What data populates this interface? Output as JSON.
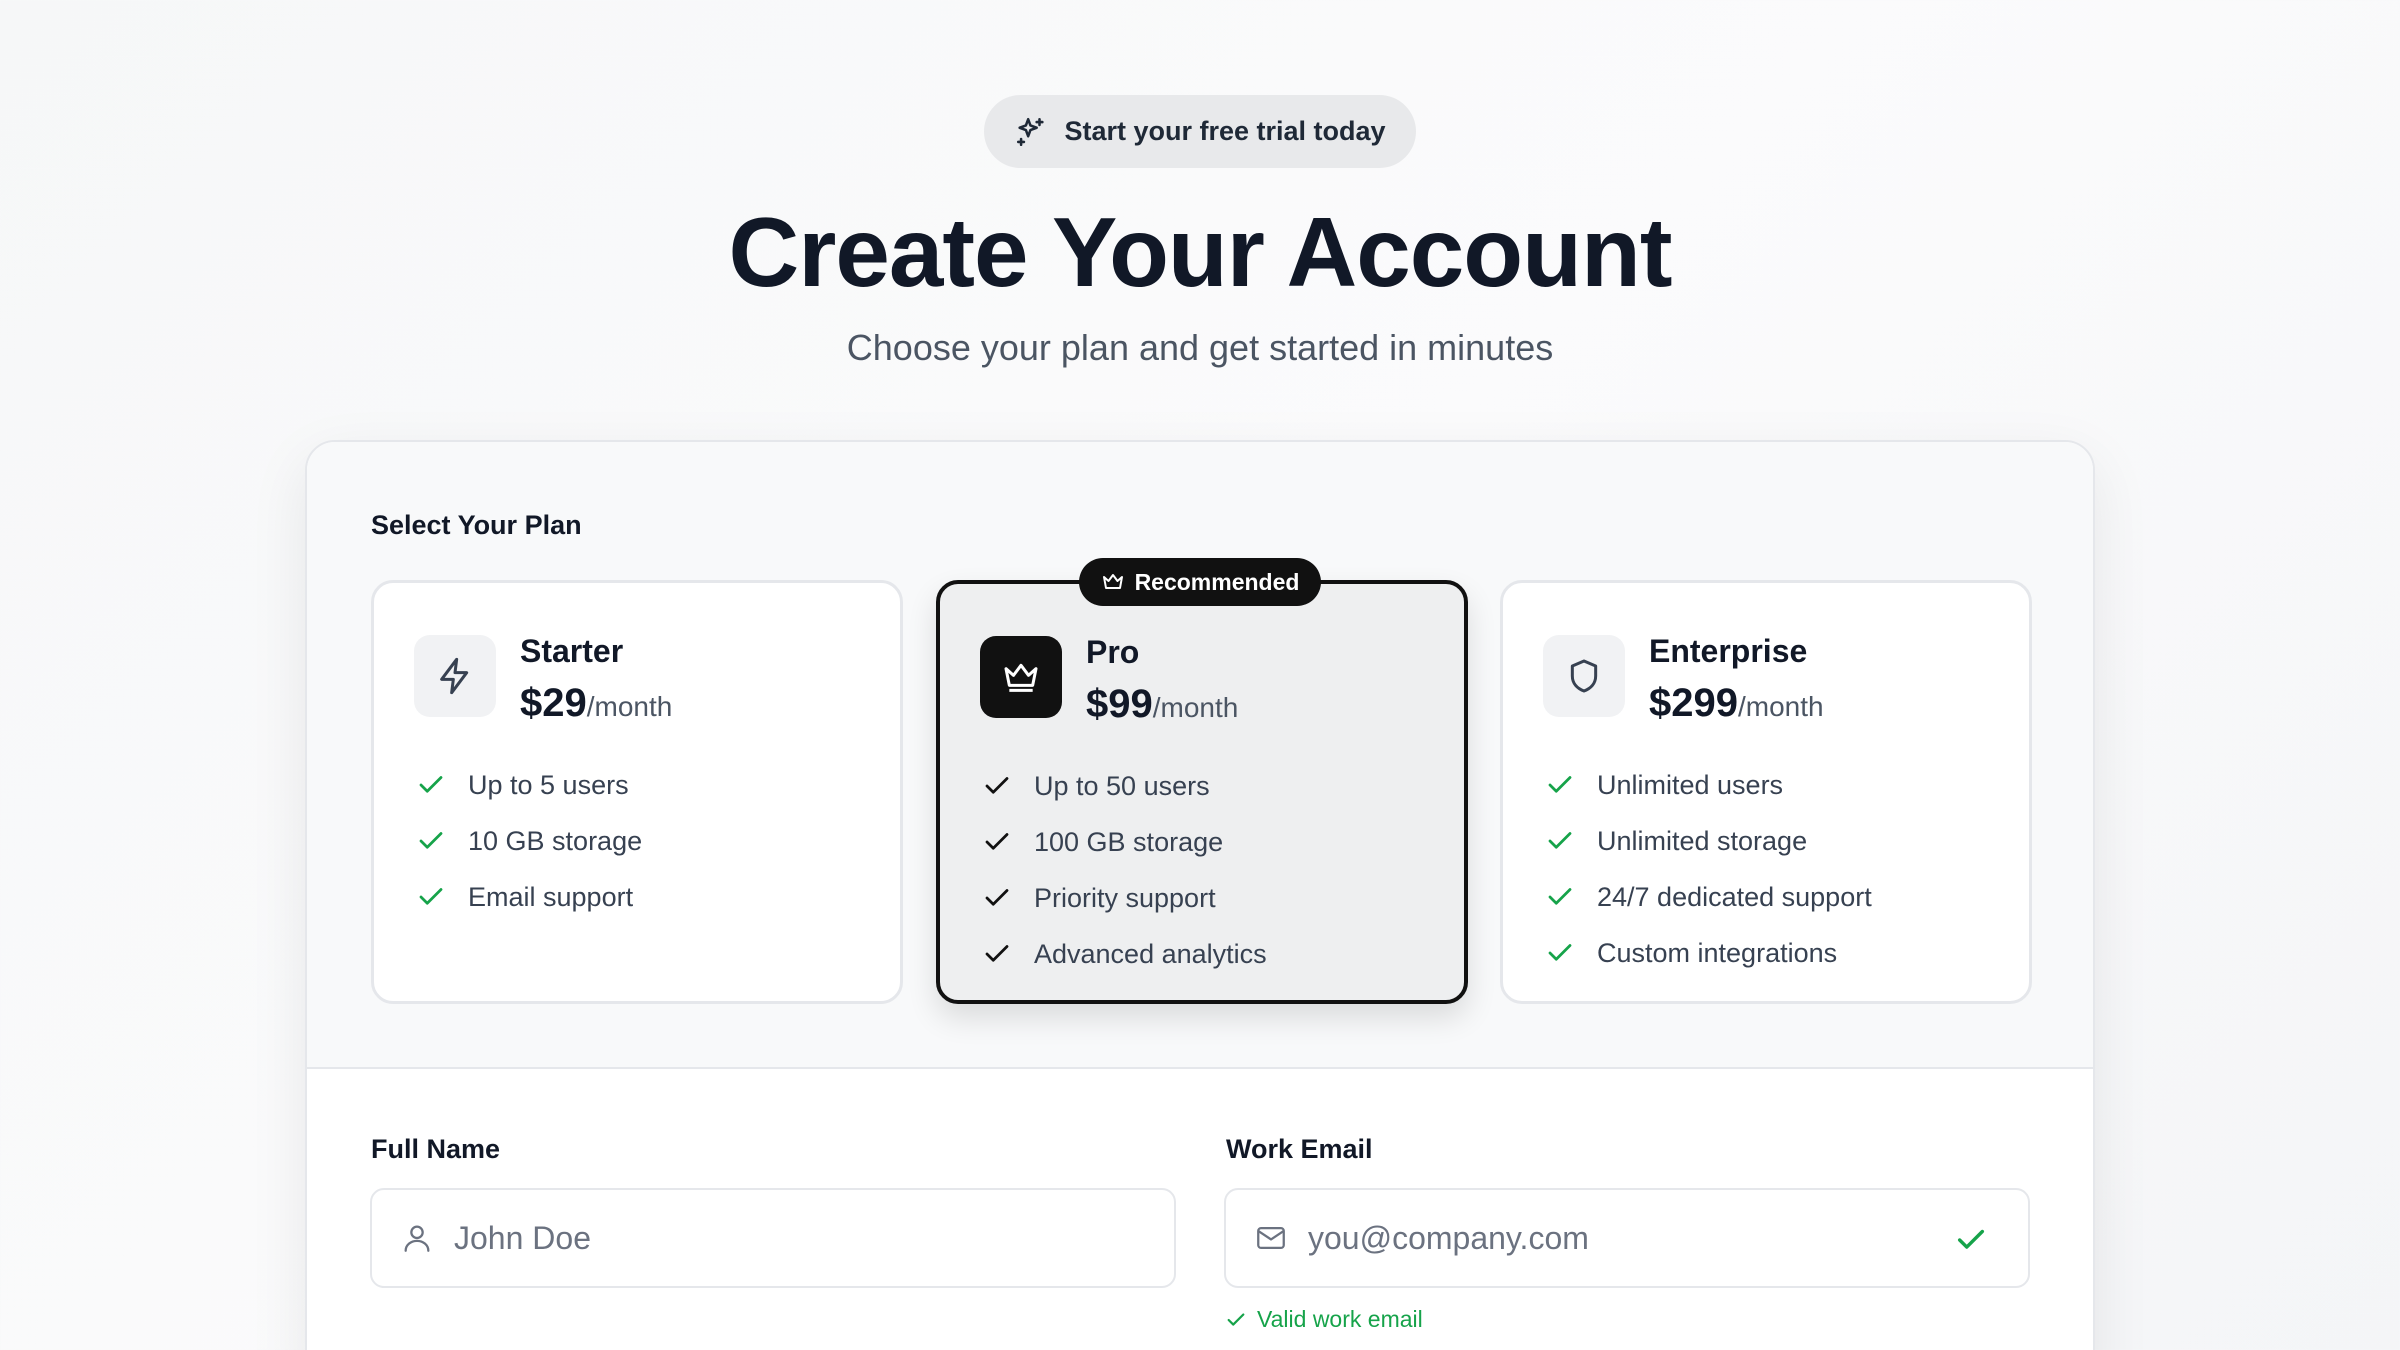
{
  "hero": {
    "pill_text": "Start your free trial today",
    "pill_icon": "sparkles-icon",
    "title": "Create Your Account",
    "subtitle": "Choose your plan and get started in minutes"
  },
  "plans_section": {
    "label": "Select Your Plan",
    "recommended_badge": "Recommended",
    "selected_plan": "Pro",
    "plans": [
      {
        "name": "Starter",
        "icon": "lightning-icon",
        "price": "$29",
        "period": "/month",
        "features": [
          "Up to 5 users",
          "10 GB storage",
          "Email support"
        ]
      },
      {
        "name": "Pro",
        "icon": "crown-icon",
        "price": "$99",
        "period": "/month",
        "features": [
          "Up to 50 users",
          "100 GB storage",
          "Priority support",
          "Advanced analytics"
        ]
      },
      {
        "name": "Enterprise",
        "icon": "shield-icon",
        "price": "$299",
        "period": "/month",
        "features": [
          "Unlimited users",
          "Unlimited storage",
          "24/7 dedicated support",
          "Custom integrations"
        ]
      }
    ]
  },
  "form": {
    "full_name": {
      "label": "Full Name",
      "placeholder": "John Doe",
      "value": ""
    },
    "work_email": {
      "label": "Work Email",
      "placeholder": "you@company.com",
      "value": "",
      "validation": "Valid work email"
    }
  },
  "colors": {
    "accent": "#111111",
    "success": "#16a34a",
    "text": "#111827",
    "muted": "#4b5563"
  }
}
